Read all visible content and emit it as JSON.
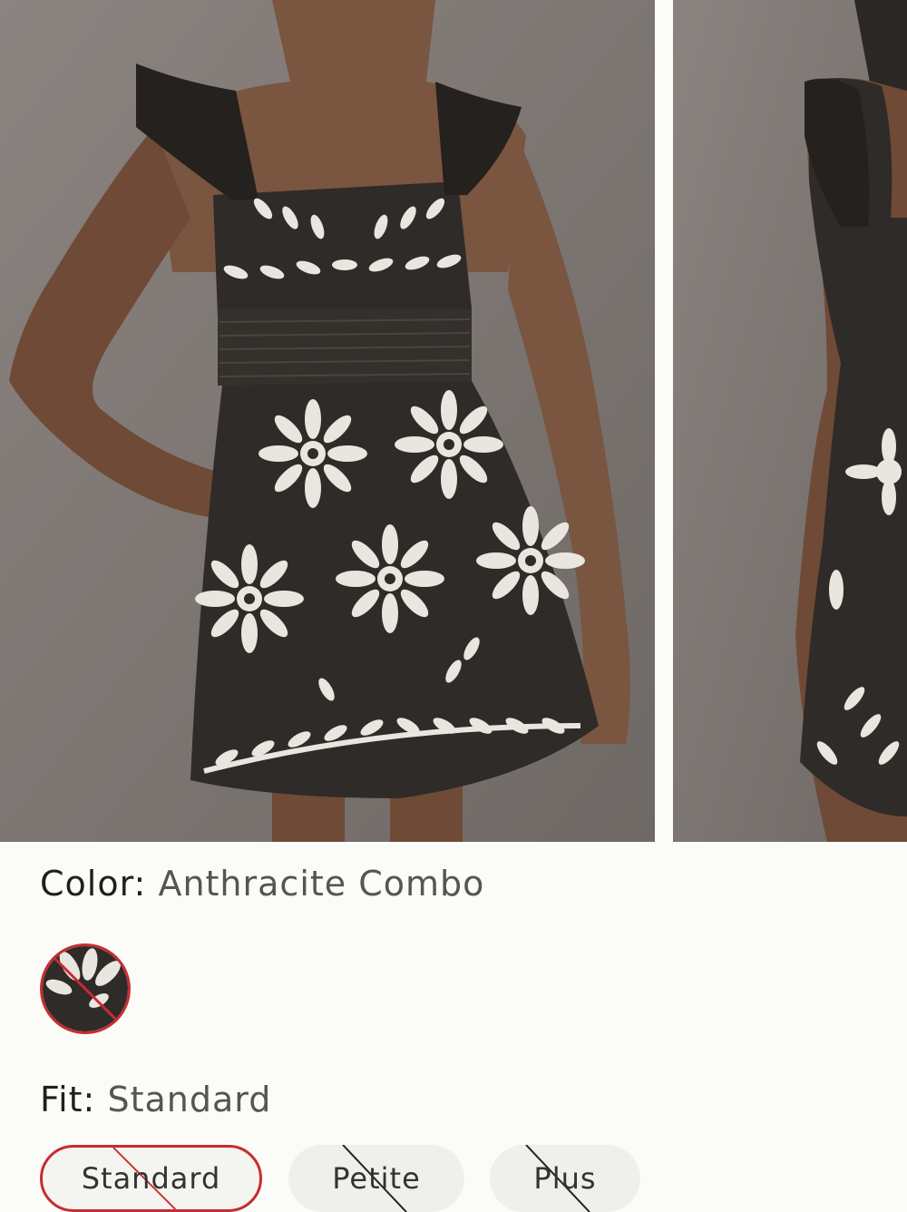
{
  "product": {
    "images": [
      {
        "alt": "front-view"
      },
      {
        "alt": "back-view"
      }
    ],
    "color": {
      "label": "Color:",
      "value": "Anthracite Combo",
      "swatch_state": "unavailable"
    },
    "fit": {
      "label": "Fit:",
      "value": "Standard",
      "options": [
        {
          "label": "Standard",
          "selected": true,
          "available": false
        },
        {
          "label": "Petite",
          "selected": false,
          "available": false
        },
        {
          "label": "Plus",
          "selected": false,
          "available": false
        }
      ]
    }
  },
  "colors": {
    "page_bg": "#fbfbf7",
    "accent_red": "#c62d32",
    "pill_bg": "#efefeb",
    "dress": "#2e2b28",
    "embroidery": "#e8e6df"
  }
}
